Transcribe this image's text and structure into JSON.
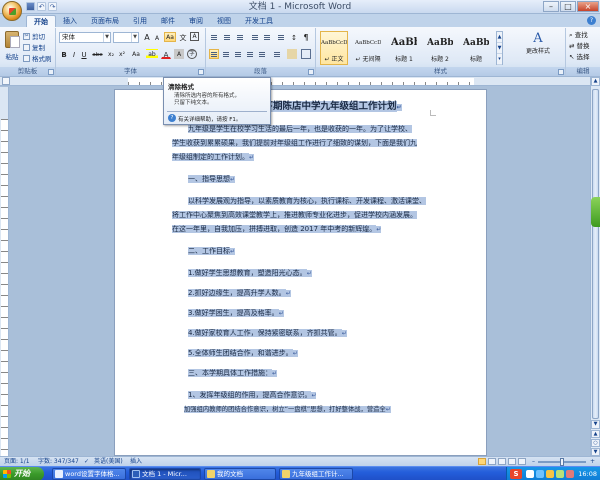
{
  "window": {
    "title": "文档 1 - Microsoft Word",
    "controls": [
      "–",
      "□",
      "×"
    ]
  },
  "tabs": [
    "开始",
    "插入",
    "页面布局",
    "引用",
    "邮件",
    "审阅",
    "视图",
    "开发工具"
  ],
  "clipboard": {
    "paste_label": "粘贴",
    "cut_label": "剪切",
    "copy_label": "复制",
    "format_painter_label": "格式刷",
    "group_label": "剪贴板"
  },
  "font": {
    "font_name": "宋体",
    "font_size": "",
    "grow_label": "A",
    "shrink_label": "A",
    "clear_label": "Aa",
    "wen_label": "文",
    "bold": "B",
    "italic": "I",
    "underline": "U",
    "strike": "abe",
    "subscript": "x₂",
    "superscript": "x²",
    "change_case": "Aa",
    "highlight": "ab",
    "font_color": "A",
    "char_border": "A",
    "char_shade": "A",
    "enclose": "字",
    "group_label": "字体"
  },
  "paragraph": {
    "group_label": "段落",
    "sort_label": "↕",
    "show_marks_label": "¶"
  },
  "styles": {
    "items": [
      {
        "preview": "AaBbCcDd",
        "name": "↵ 正文"
      },
      {
        "preview": "AaBbCcDd",
        "name": "↵ 无间隔"
      },
      {
        "preview": "AaBb",
        "name": "标题 1"
      },
      {
        "preview": "AaBb(",
        "name": "标题 2"
      },
      {
        "preview": "AaBb(",
        "name": "标题"
      }
    ],
    "change_styles_icon": "A",
    "change_styles_label": "更改样式",
    "group_label": "样式",
    "scroll": [
      "▲",
      "▼",
      "▾"
    ]
  },
  "editing": {
    "find_label": "查找",
    "replace_label": "替换",
    "select_label": "选择",
    "group_label": "编辑"
  },
  "tooltip": {
    "title": "清除格式",
    "body": "清除所选内容的所有格式，\n只留下纯文本。",
    "help": "有关详细帮助，请按 F1。",
    "help_icon": "?"
  },
  "document": {
    "title": "17 下期陈店中学九年级组工作计划",
    "paragraph_mark": "↵",
    "lines": [
      "九年级是学生在校学习生活的最后一年，也是收获的一年。为了让学校、",
      "学生收获到累累硕果，我们提前对年级组工作进行了细致的谋划，下面是我们九",
      "年级组制定的工作计划。",
      "一、指导思想",
      "以科学发展观为指导，以素质教育为核心，执行课标、开发课程、激活课堂、",
      "将工作中心聚焦到高效课堂教学上，推进教师专业化进步，促进学校内涵发展。",
      "在这一年里，自我加压，拼搏进取，创造 2017 年中考的新辉煌。",
      "二、工作目标",
      "1.做好学生思想教育，塑造阳光心态。",
      "2.抓好边缘生，提高升学人数。",
      "3.做好学困生，提高及格率。",
      "4.做好家校育人工作，保持紧密联系，齐抓共管。",
      "5.全体师生团结合作，和谐进步。",
      "三、本学期具体工作措施：",
      "1、发挥年级组的作用，提高合作意识。",
      "加强组内教师的团结合作意识，树立“一盘棋”思想，打好整体战，营造全"
    ]
  },
  "statusbar": {
    "page": "页面: 1/1",
    "words": "字数: 347/347",
    "proof_icon": "✓",
    "language": "英语(美国)",
    "insert_mode": "插入",
    "zoom_minus": "–",
    "zoom_plus": "+"
  },
  "scrollbar": {
    "up": "▲",
    "down": "▼",
    "nav": [
      "▲",
      "○",
      "▼"
    ]
  },
  "taskbar": {
    "start_label": "开始",
    "tasks": [
      "word设置字体格...",
      "文档 1 - Micr...",
      "我的文档",
      "九年级组工作计..."
    ],
    "ime_label": "S",
    "clock": "16:08"
  },
  "colors": {
    "selection": "#b3c6e3",
    "ribbon_text": "#15428b",
    "taskbar": "#245edb",
    "start_button": "#3a9a2a"
  }
}
